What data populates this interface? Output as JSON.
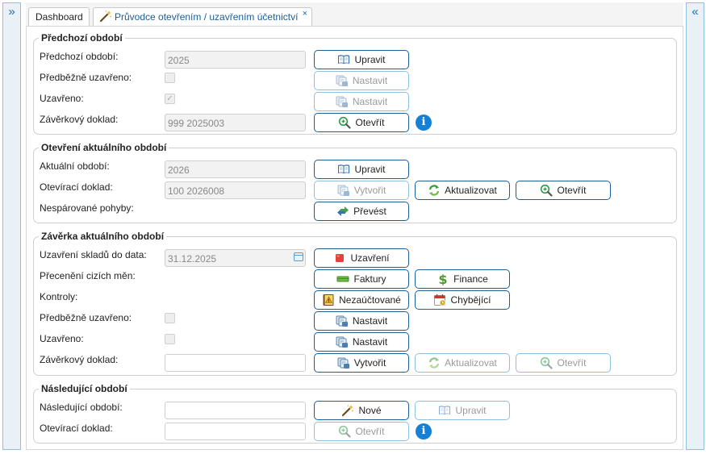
{
  "nav": {
    "expand_icon": "»",
    "collapse_icon": "«"
  },
  "tabs": {
    "dashboard": "Dashboard",
    "wizard": "Průvodce otevřením / uzavřením účetnictví",
    "close_icon": "×"
  },
  "prev_period": {
    "legend": "Předchozí období",
    "period_label": "Předchozí období:",
    "period_value": "2025",
    "edit_button": "Upravit",
    "prelim_label": "Předběžně uzavřeno:",
    "prelim_set_button": "Nastavit",
    "closed_label": "Uzavřeno:",
    "closed_set_button": "Nastavit",
    "doc_label": "Závěrkový doklad:",
    "doc_value": "999 2025003",
    "open_button": "Otevřít",
    "info_icon": "i"
  },
  "open_current": {
    "legend": "Otevření aktuálního období",
    "period_label": "Aktuální období:",
    "period_value": "2026",
    "edit_button": "Upravit",
    "doc_label": "Otevírací doklad:",
    "doc_value": "100 2026008",
    "create_button": "Vytvořit",
    "update_button": "Aktualizovat",
    "open_button": "Otevřít",
    "unmatched_label": "Nespárované pohyby:",
    "transfer_button": "Převést"
  },
  "close_current": {
    "legend": "Závěrka aktuálního období",
    "stock_label": "Uzavření skladů do data:",
    "stock_value": "31.12.2025",
    "close_button": "Uzavření",
    "reval_label": "Přecenění cizích měn:",
    "invoices_button": "Faktury",
    "finance_button": "Finance",
    "checks_label": "Kontroly:",
    "unposted_button": "Nezaúčtované",
    "missing_button": "Chybějící",
    "prelim_label": "Předběžně uzavřeno:",
    "prelim_set_button": "Nastavit",
    "closed_label": "Uzavřeno:",
    "closed_set_button": "Nastavit",
    "doc_label": "Závěrkový doklad:",
    "doc_value": "",
    "create_button": "Vytvořit",
    "update_button": "Aktualizovat",
    "open_button": "Otevřít"
  },
  "next_period": {
    "legend": "Následující období",
    "period_label": "Následující období:",
    "period_value": "",
    "new_button": "Nové",
    "edit_button": "Upravit",
    "doc_label": "Otevírací doklad:",
    "doc_value": "",
    "open_button": "Otevřít",
    "info_icon": "i"
  },
  "colors": {
    "accent": "#1b5f99",
    "info": "#1481d6",
    "panel_border": "#8fc0df"
  }
}
